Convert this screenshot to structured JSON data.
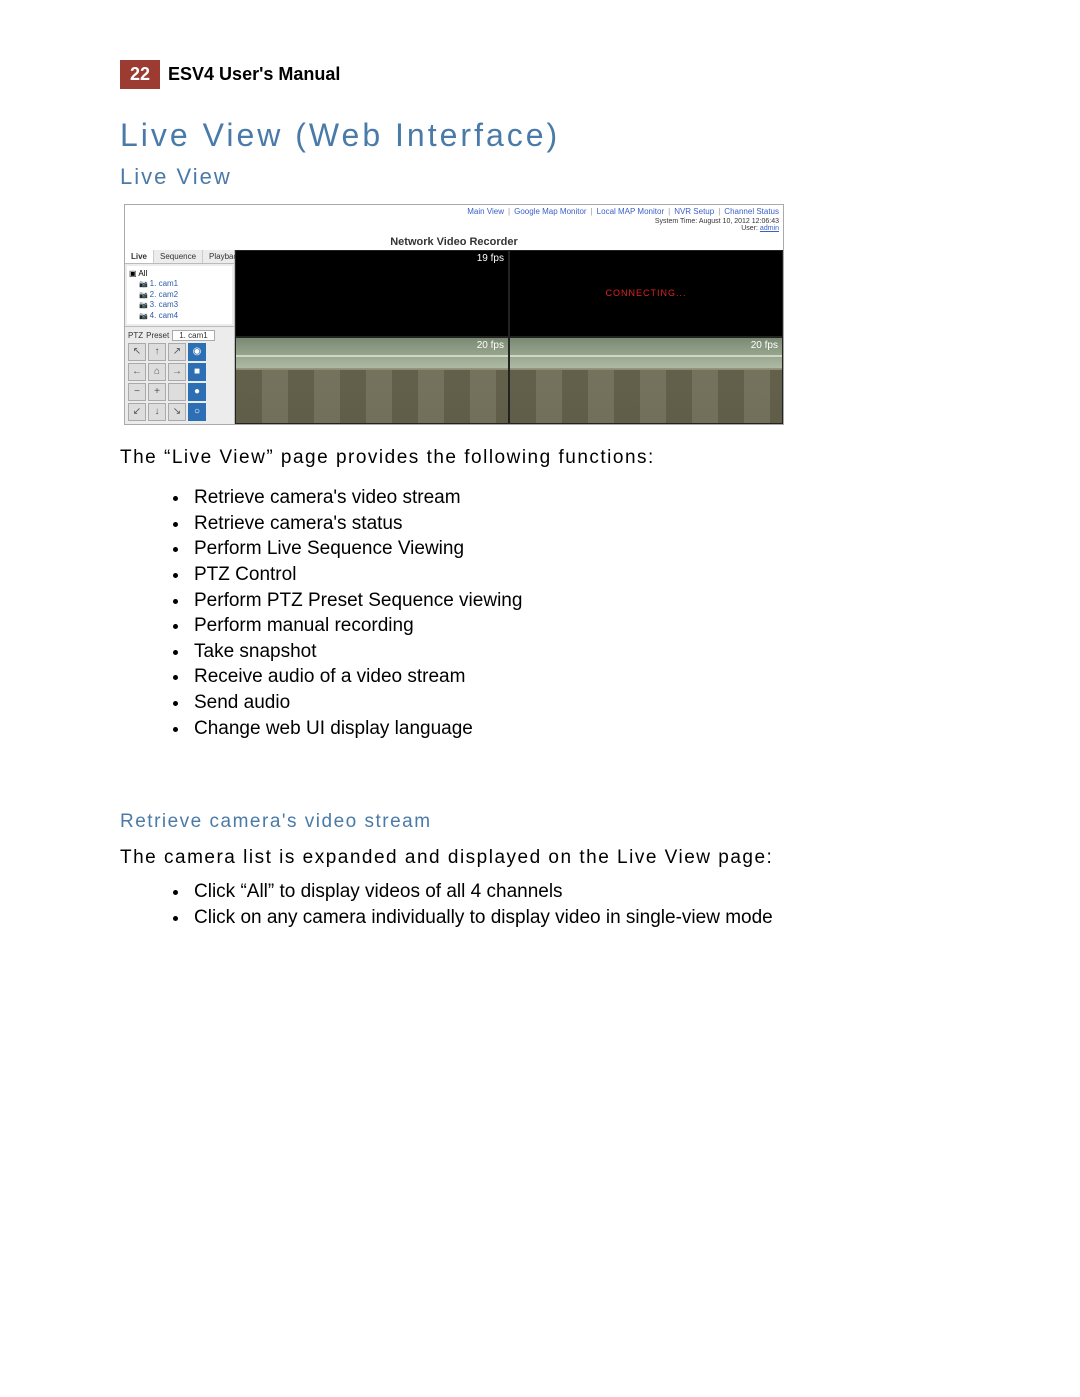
{
  "header": {
    "page_number": "22",
    "manual_title": "ESV4 User's Manual"
  },
  "section_title": "Live View (Web Interface)",
  "subsection_title": "Live View",
  "screenshot": {
    "top_links": [
      "Main View",
      "Google Map Monitor",
      "Local MAP Monitor",
      "NVR Setup",
      "Channel Status"
    ],
    "system_time_label": "System Time: August 10, 2012 12:06:43",
    "user_label": "User:",
    "user_name": "admin",
    "app_title": "Network Video Recorder",
    "tabs": {
      "live": "Live",
      "t2": "Sequence",
      "t3": "Playback"
    },
    "camera_tree": {
      "root": "All",
      "cams": [
        "1. cam1",
        "2. cam2",
        "3. cam3",
        "4. cam4"
      ]
    },
    "ptz": {
      "label": "PTZ",
      "preset": "Preset",
      "selected": "1. cam1"
    },
    "cells": {
      "tl_fps": "19 fps",
      "tr_text": "CONNECTING...",
      "bl_fps": "20 fps",
      "br_fps": "20 fps"
    }
  },
  "intro_line": "The “Live View” page provides the following functions:",
  "functions": [
    "Retrieve camera's video stream",
    "Retrieve camera's status",
    "Perform Live Sequence Viewing",
    "PTZ Control",
    "Perform PTZ Preset Sequence viewing",
    "Perform manual recording",
    "Take snapshot",
    "Receive audio of a video stream",
    "Send audio",
    "Change web UI display language"
  ],
  "retrieve": {
    "heading": "Retrieve camera's video stream",
    "lead": "The camera list is expanded and displayed on the Live View page:",
    "bullets": [
      "Click “All” to display videos of all 4 channels",
      "Click on any camera individually to display video in single-view mode"
    ]
  }
}
